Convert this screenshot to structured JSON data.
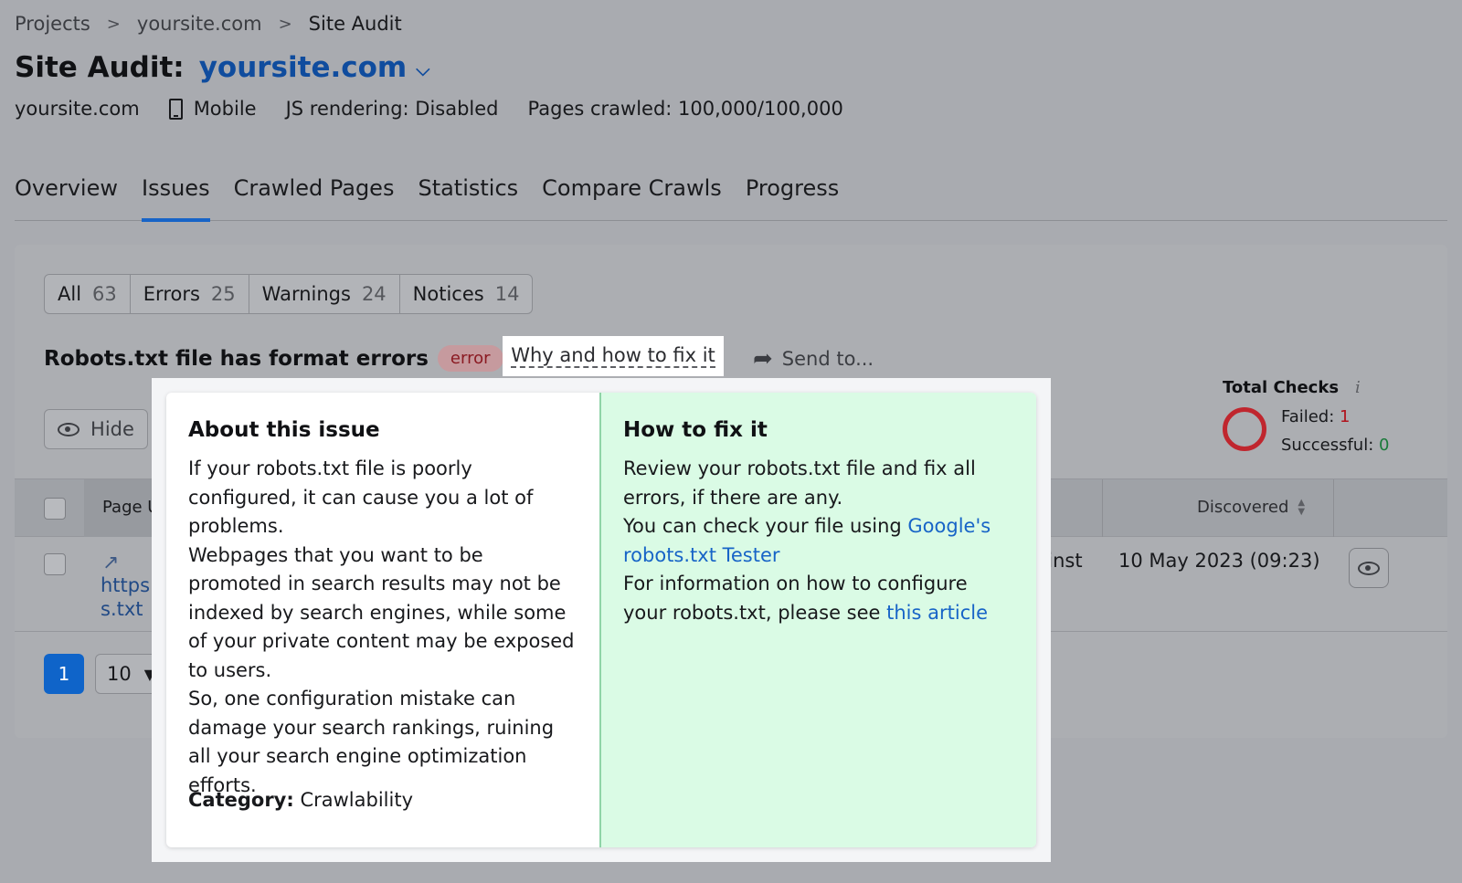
{
  "breadcrumb": {
    "items": [
      "Projects",
      "yoursite.com",
      "Site Audit"
    ],
    "separator": ">"
  },
  "header": {
    "title_prefix": "Site Audit:",
    "domain": "yoursite.com",
    "chevron": "⌄"
  },
  "meta": {
    "site": "yoursite.com",
    "device": "Mobile",
    "js_rendering": "JS rendering: Disabled",
    "pages_crawled": "Pages crawled: 100,000/100,000"
  },
  "tabs": [
    {
      "label": "Overview"
    },
    {
      "label": "Issues",
      "active": true
    },
    {
      "label": "Crawled Pages"
    },
    {
      "label": "Statistics"
    },
    {
      "label": "Compare Crawls"
    },
    {
      "label": "Progress"
    }
  ],
  "filters": [
    {
      "label": "All",
      "count": "63"
    },
    {
      "label": "Errors",
      "count": "25"
    },
    {
      "label": "Warnings",
      "count": "24"
    },
    {
      "label": "Notices",
      "count": "14"
    }
  ],
  "issue": {
    "title": "Robots.txt file has format errors",
    "badge": "error",
    "why_link": "Why and how to fix it",
    "send_to": "Send to..."
  },
  "hide_button": "Hide",
  "total_checks": {
    "title": "Total Checks",
    "info": "i",
    "failed_label": "Failed:",
    "failed_value": "1",
    "successful_label": "Successful:",
    "successful_value": "0"
  },
  "table": {
    "col_url": "Page Ul",
    "col_discovered": "Discovered",
    "row": {
      "url_line1": "https:/",
      "url_line2": "s.txt",
      "instruction_fragment": "xt-inst",
      "discovered": "10 May 2023 (09:23)"
    }
  },
  "pagination": {
    "current_page": "1",
    "per_page": "10"
  },
  "popup": {
    "about_title": "About this issue",
    "about_paragraphs": [
      "If your robots.txt file is poorly configured, it can cause you a lot of problems.",
      "Webpages that you want to be promoted in search results may not be indexed by search engines, while some of your private content may be exposed to users.",
      "So, one configuration mistake can damage your search rankings, ruining all your search engine optimization efforts."
    ],
    "category_label": "Category:",
    "category_value": "Crawlability",
    "fix_title": "How to fix it",
    "fix_p1": "Review your robots.txt file and fix all errors, if there are any.",
    "fix_p2_text": "You can check your file using ",
    "fix_p2_link": "Google's robots.txt Tester",
    "fix_p3_text": "For information on how to configure your robots.txt, please see ",
    "fix_p3_link": "this article"
  },
  "colors": {
    "accent": "#1764c7",
    "domain": "#0f4c9e",
    "error": "#b0121c",
    "success": "#1a7a3a",
    "fix_bg": "#dafbe5"
  }
}
